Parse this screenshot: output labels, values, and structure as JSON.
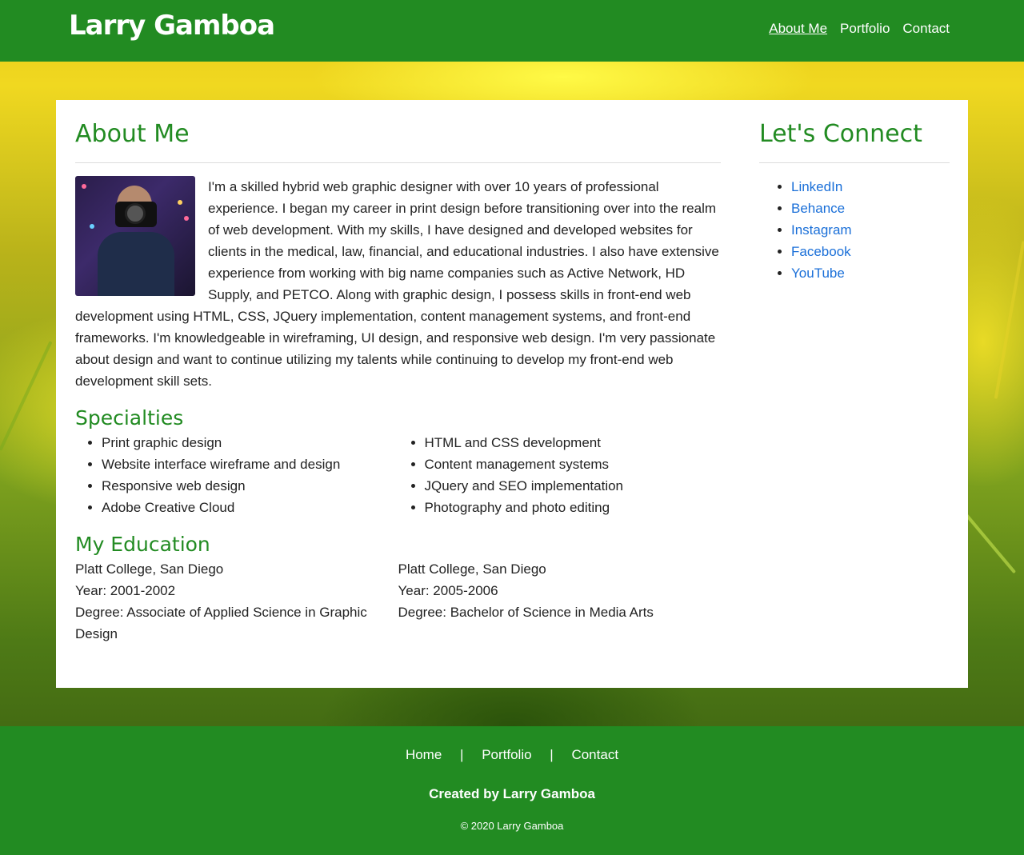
{
  "site": {
    "brand": "Larry Gamboa"
  },
  "nav": {
    "items": [
      "About Me",
      "Portfolio",
      "Contact"
    ]
  },
  "about": {
    "title": "About Me",
    "photo_alt": "photographer-with-camera",
    "text": "I'm a skilled hybrid web graphic designer with over 10 years of professional experience. I began my career in print design before transitioning over into the realm of web development. With my skills, I have designed and developed websites for clients in the medical, law, financial, and educational industries. I also have extensive experience from working with big name companies such as Active Network, HD Supply, and PETCO. Along with graphic design, I possess skills in front-end web development using HTML, CSS, JQuery implementation, content management systems, and front-end frameworks. I'm knowledgeable in wireframing, UI design, and responsive web design. I'm very passionate about design and want to continue utilizing my talents while continuing to develop my front-end web development skill sets."
  },
  "specialties": {
    "title": "Specialties",
    "left": [
      "Print graphic design",
      "Website interface wireframe and design",
      "Responsive web design",
      "Adobe Creative Cloud"
    ],
    "right": [
      "HTML and CSS development",
      "Content management systems",
      "JQuery and SEO implementation",
      "Photography and photo editing"
    ]
  },
  "education": {
    "title": "My Education",
    "entries": [
      {
        "school": "Platt College, San Diego",
        "year": "Year: 2001-2002",
        "degree": "Degree: Associate of Applied Science in Graphic Design"
      },
      {
        "school": "Platt College, San Diego",
        "year": "Year: 2005-2006",
        "degree": "Degree: Bachelor of Science in Media Arts"
      }
    ]
  },
  "connect": {
    "title": "Let's Connect",
    "links": [
      "LinkedIn",
      "Behance",
      "Instagram",
      "Facebook",
      "YouTube"
    ]
  },
  "footer": {
    "nav": [
      "Home",
      "Portfolio",
      "Contact"
    ],
    "separator": "|",
    "created": "Created by Larry Gamboa",
    "copyright": "© 2020 Larry Gamboa"
  },
  "colors": {
    "green": "#228b22",
    "link": "#1a6fd8"
  }
}
